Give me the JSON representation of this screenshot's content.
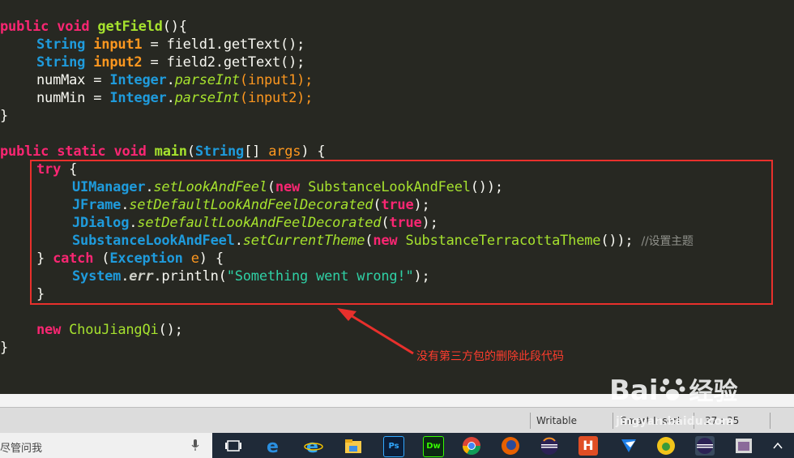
{
  "code_lines": {
    "l1": {
      "a": "public void ",
      "b": "getField",
      "c": "(){"
    },
    "l2": {
      "a": "String ",
      "b": "input1",
      "c": " = field1.getText();"
    },
    "l3": {
      "a": "String ",
      "b": "input2",
      "c": " = field2.getText();"
    },
    "l4": {
      "a": "numMax = ",
      "b": "Integer",
      ".": ".",
      "c": "parseInt",
      "d": "(input1);"
    },
    "l5": {
      "a": "numMin = ",
      "b": "Integer",
      ".": ".",
      "c": "parseInt",
      "d": "(input2);"
    },
    "l6": "}",
    "l8": {
      "a": "public static void ",
      "b": "main",
      "c": "(",
      "d": "String",
      "e": "[] ",
      "f": "args",
      ")": ") {"
    },
    "l9": {
      "a": "try ",
      "b": "{"
    },
    "l10": {
      "a": "UIManager",
      ".": ".",
      "b": "setLookAndFeel",
      "c": "(",
      "d": "new ",
      "e": "SubstanceLookAndFeel",
      "f": "());"
    },
    "l11": {
      "a": "JFrame",
      ".": ".",
      "b": "setDefaultLookAndFeelDecorated",
      "c": "(",
      "d": "true",
      "e": ");"
    },
    "l12": {
      "a": "JDialog",
      ".": ".",
      "b": "setDefaultLookAndFeelDecorated",
      "c": "(",
      "d": "true",
      "e": ");"
    },
    "l13": {
      "a": "SubstanceLookAndFeel",
      ".": ".",
      "b": "setCurrentTheme",
      "c": "(",
      "d": "new ",
      "e": "SubstanceTerracottaTheme",
      "f": "()); ",
      "g": "//设置主题"
    },
    "l14": {
      "a": "} ",
      "b": "catch ",
      "c": "(",
      "d": "Exception ",
      "e": "e",
      "f": ") {"
    },
    "l15": {
      "a": "System",
      ".": ".",
      "b": "err",
      ".2": ".println(",
      "c": "\"Something went wrong!\"",
      "d": ");"
    },
    "l16": "}",
    "l18": {
      "a": "new ",
      "b": "ChouJiangQi",
      "c": "();"
    },
    "l19": "}"
  },
  "annotation": "没有第三方包的删除此段代码",
  "statusbar": {
    "writable": "Writable",
    "insert_mode": "Smart Insert",
    "position": "37 : 35"
  },
  "taskbar": {
    "search_placeholder": "尽管问我",
    "apps": [
      "task-view",
      "edge",
      "ie",
      "file-explorer",
      "photoshop",
      "dreamweaver",
      "chrome",
      "firefox",
      "eclipse",
      "hbuilder",
      "qq",
      "eclipse-2",
      "app-12"
    ],
    "ps_label": "Ps",
    "dw_label": "Dw",
    "h_label": "H"
  },
  "watermark": {
    "brand": "Bai",
    "brand2": "经验",
    "url": "jingyan.baidu.com"
  },
  "colors": {
    "editor_bg": "#272822",
    "highlight": "#e8302c",
    "keyword": "#f92672",
    "type": "#1f9bdc",
    "function": "#a6e22e"
  }
}
